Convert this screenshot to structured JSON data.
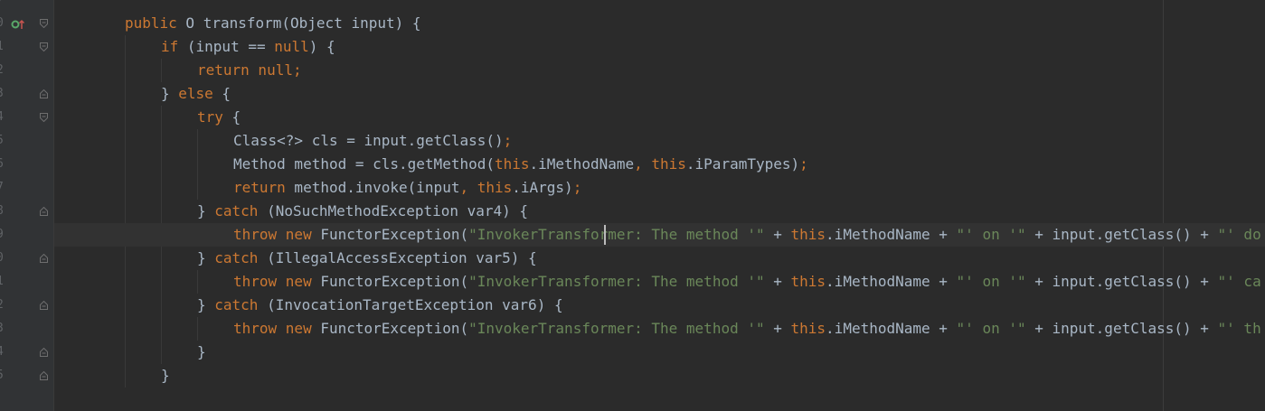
{
  "editor": {
    "language": "java",
    "colors": {
      "background": "#2b2b2b",
      "gutter": "#313335",
      "keyword": "#cc7832",
      "string": "#6a8759",
      "text": "#a9b7c6",
      "line_number": "#606366",
      "override_marker": "#59a869"
    },
    "line_numbers": [
      "7",
      "0",
      "1",
      "2",
      "3",
      "4",
      "5",
      "6",
      "7",
      "8",
      "9",
      "0",
      "1",
      "2",
      "3",
      "4",
      "5"
    ],
    "lines": [
      {
        "indent": 0,
        "tokens": []
      },
      {
        "indent": 1,
        "tokens": [
          [
            "kw",
            "public"
          ],
          [
            "t",
            " O transform(Object input) {"
          ]
        ]
      },
      {
        "indent": 2,
        "tokens": [
          [
            "kw",
            "if"
          ],
          [
            "t",
            " (input == "
          ],
          [
            "kw",
            "null"
          ],
          [
            "t",
            ") {"
          ]
        ]
      },
      {
        "indent": 3,
        "tokens": [
          [
            "kw",
            "return null;"
          ]
        ]
      },
      {
        "indent": 2,
        "tokens": [
          [
            "t",
            "} "
          ],
          [
            "kw",
            "else"
          ],
          [
            "t",
            " {"
          ]
        ]
      },
      {
        "indent": 3,
        "tokens": [
          [
            "kw",
            "try"
          ],
          [
            "t",
            " {"
          ]
        ]
      },
      {
        "indent": 4,
        "tokens": [
          [
            "t",
            "Class<?> cls = input.getClass()"
          ],
          [
            "kw",
            ";"
          ]
        ]
      },
      {
        "indent": 4,
        "tokens": [
          [
            "t",
            "Method method = cls.getMethod("
          ],
          [
            "kw",
            "this"
          ],
          [
            "t",
            ".iMethodName"
          ],
          [
            "kw",
            ", this"
          ],
          [
            "t",
            ".iParamTypes)"
          ],
          [
            "kw",
            ";"
          ]
        ]
      },
      {
        "indent": 4,
        "tokens": [
          [
            "kw",
            "return"
          ],
          [
            "t",
            " method.invoke(input"
          ],
          [
            "kw",
            ", this"
          ],
          [
            "t",
            ".iArgs)"
          ],
          [
            "kw",
            ";"
          ]
        ]
      },
      {
        "indent": 3,
        "tokens": [
          [
            "t",
            "} "
          ],
          [
            "kw",
            "catch"
          ],
          [
            "t",
            " (NoSuchMethodException var4) {"
          ]
        ]
      },
      {
        "indent": 4,
        "tokens": [
          [
            "kw",
            "throw new"
          ],
          [
            "t",
            " FunctorException("
          ],
          [
            "str",
            "\"InvokerTransformer: The method '\""
          ],
          [
            "t",
            " + "
          ],
          [
            "kw",
            "this"
          ],
          [
            "t",
            ".iMethodName + "
          ],
          [
            "str",
            "\"' on '\""
          ],
          [
            "t",
            " + input.getClass() + "
          ],
          [
            "str",
            "\"' do"
          ]
        ]
      },
      {
        "indent": 3,
        "tokens": [
          [
            "t",
            "} "
          ],
          [
            "kw",
            "catch"
          ],
          [
            "t",
            " (IllegalAccessException var5) {"
          ]
        ]
      },
      {
        "indent": 4,
        "tokens": [
          [
            "kw",
            "throw new"
          ],
          [
            "t",
            " FunctorException("
          ],
          [
            "str",
            "\"InvokerTransformer: The method '\""
          ],
          [
            "t",
            " + "
          ],
          [
            "kw",
            "this"
          ],
          [
            "t",
            ".iMethodName + "
          ],
          [
            "str",
            "\"' on '\""
          ],
          [
            "t",
            " + input.getClass() + "
          ],
          [
            "str",
            "\"' ca"
          ]
        ]
      },
      {
        "indent": 3,
        "tokens": [
          [
            "t",
            "} "
          ],
          [
            "kw",
            "catch"
          ],
          [
            "t",
            " (InvocationTargetException var6) {"
          ]
        ]
      },
      {
        "indent": 4,
        "tokens": [
          [
            "kw",
            "throw new"
          ],
          [
            "t",
            " FunctorException("
          ],
          [
            "str",
            "\"InvokerTransformer: The method '\""
          ],
          [
            "t",
            " + "
          ],
          [
            "kw",
            "this"
          ],
          [
            "t",
            ".iMethodName + "
          ],
          [
            "str",
            "\"' on '\""
          ],
          [
            "t",
            " + input.getClass() + "
          ],
          [
            "str",
            "\"' th"
          ]
        ]
      },
      {
        "indent": 3,
        "tokens": [
          [
            "t",
            "}"
          ]
        ]
      },
      {
        "indent": 2,
        "tokens": [
          [
            "t",
            "}"
          ]
        ]
      }
    ],
    "fold_markers": [
      "",
      "open",
      "open",
      "",
      "close",
      "open",
      "",
      "",
      "",
      "close",
      "",
      "close",
      "",
      "close",
      "",
      "close",
      "close"
    ],
    "override_line": 1,
    "current_line": 10
  }
}
